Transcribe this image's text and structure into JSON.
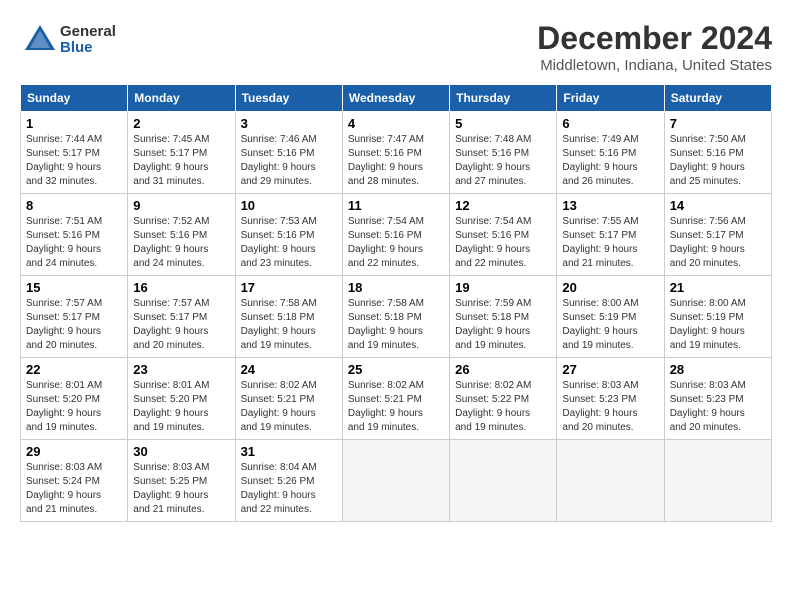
{
  "logo": {
    "general": "General",
    "blue": "Blue"
  },
  "title": "December 2024",
  "subtitle": "Middletown, Indiana, United States",
  "days_of_week": [
    "Sunday",
    "Monday",
    "Tuesday",
    "Wednesday",
    "Thursday",
    "Friday",
    "Saturday"
  ],
  "weeks": [
    [
      {
        "day": "1",
        "info": "Sunrise: 7:44 AM\nSunset: 5:17 PM\nDaylight: 9 hours\nand 32 minutes."
      },
      {
        "day": "2",
        "info": "Sunrise: 7:45 AM\nSunset: 5:17 PM\nDaylight: 9 hours\nand 31 minutes."
      },
      {
        "day": "3",
        "info": "Sunrise: 7:46 AM\nSunset: 5:16 PM\nDaylight: 9 hours\nand 29 minutes."
      },
      {
        "day": "4",
        "info": "Sunrise: 7:47 AM\nSunset: 5:16 PM\nDaylight: 9 hours\nand 28 minutes."
      },
      {
        "day": "5",
        "info": "Sunrise: 7:48 AM\nSunset: 5:16 PM\nDaylight: 9 hours\nand 27 minutes."
      },
      {
        "day": "6",
        "info": "Sunrise: 7:49 AM\nSunset: 5:16 PM\nDaylight: 9 hours\nand 26 minutes."
      },
      {
        "day": "7",
        "info": "Sunrise: 7:50 AM\nSunset: 5:16 PM\nDaylight: 9 hours\nand 25 minutes."
      }
    ],
    [
      {
        "day": "8",
        "info": "Sunrise: 7:51 AM\nSunset: 5:16 PM\nDaylight: 9 hours\nand 24 minutes."
      },
      {
        "day": "9",
        "info": "Sunrise: 7:52 AM\nSunset: 5:16 PM\nDaylight: 9 hours\nand 24 minutes."
      },
      {
        "day": "10",
        "info": "Sunrise: 7:53 AM\nSunset: 5:16 PM\nDaylight: 9 hours\nand 23 minutes."
      },
      {
        "day": "11",
        "info": "Sunrise: 7:54 AM\nSunset: 5:16 PM\nDaylight: 9 hours\nand 22 minutes."
      },
      {
        "day": "12",
        "info": "Sunrise: 7:54 AM\nSunset: 5:16 PM\nDaylight: 9 hours\nand 22 minutes."
      },
      {
        "day": "13",
        "info": "Sunrise: 7:55 AM\nSunset: 5:17 PM\nDaylight: 9 hours\nand 21 minutes."
      },
      {
        "day": "14",
        "info": "Sunrise: 7:56 AM\nSunset: 5:17 PM\nDaylight: 9 hours\nand 20 minutes."
      }
    ],
    [
      {
        "day": "15",
        "info": "Sunrise: 7:57 AM\nSunset: 5:17 PM\nDaylight: 9 hours\nand 20 minutes."
      },
      {
        "day": "16",
        "info": "Sunrise: 7:57 AM\nSunset: 5:17 PM\nDaylight: 9 hours\nand 20 minutes."
      },
      {
        "day": "17",
        "info": "Sunrise: 7:58 AM\nSunset: 5:18 PM\nDaylight: 9 hours\nand 19 minutes."
      },
      {
        "day": "18",
        "info": "Sunrise: 7:58 AM\nSunset: 5:18 PM\nDaylight: 9 hours\nand 19 minutes."
      },
      {
        "day": "19",
        "info": "Sunrise: 7:59 AM\nSunset: 5:18 PM\nDaylight: 9 hours\nand 19 minutes."
      },
      {
        "day": "20",
        "info": "Sunrise: 8:00 AM\nSunset: 5:19 PM\nDaylight: 9 hours\nand 19 minutes."
      },
      {
        "day": "21",
        "info": "Sunrise: 8:00 AM\nSunset: 5:19 PM\nDaylight: 9 hours\nand 19 minutes."
      }
    ],
    [
      {
        "day": "22",
        "info": "Sunrise: 8:01 AM\nSunset: 5:20 PM\nDaylight: 9 hours\nand 19 minutes."
      },
      {
        "day": "23",
        "info": "Sunrise: 8:01 AM\nSunset: 5:20 PM\nDaylight: 9 hours\nand 19 minutes."
      },
      {
        "day": "24",
        "info": "Sunrise: 8:02 AM\nSunset: 5:21 PM\nDaylight: 9 hours\nand 19 minutes."
      },
      {
        "day": "25",
        "info": "Sunrise: 8:02 AM\nSunset: 5:21 PM\nDaylight: 9 hours\nand 19 minutes."
      },
      {
        "day": "26",
        "info": "Sunrise: 8:02 AM\nSunset: 5:22 PM\nDaylight: 9 hours\nand 19 minutes."
      },
      {
        "day": "27",
        "info": "Sunrise: 8:03 AM\nSunset: 5:23 PM\nDaylight: 9 hours\nand 20 minutes."
      },
      {
        "day": "28",
        "info": "Sunrise: 8:03 AM\nSunset: 5:23 PM\nDaylight: 9 hours\nand 20 minutes."
      }
    ],
    [
      {
        "day": "29",
        "info": "Sunrise: 8:03 AM\nSunset: 5:24 PM\nDaylight: 9 hours\nand 21 minutes."
      },
      {
        "day": "30",
        "info": "Sunrise: 8:03 AM\nSunset: 5:25 PM\nDaylight: 9 hours\nand 21 minutes."
      },
      {
        "day": "31",
        "info": "Sunrise: 8:04 AM\nSunset: 5:26 PM\nDaylight: 9 hours\nand 22 minutes."
      },
      null,
      null,
      null,
      null
    ]
  ]
}
